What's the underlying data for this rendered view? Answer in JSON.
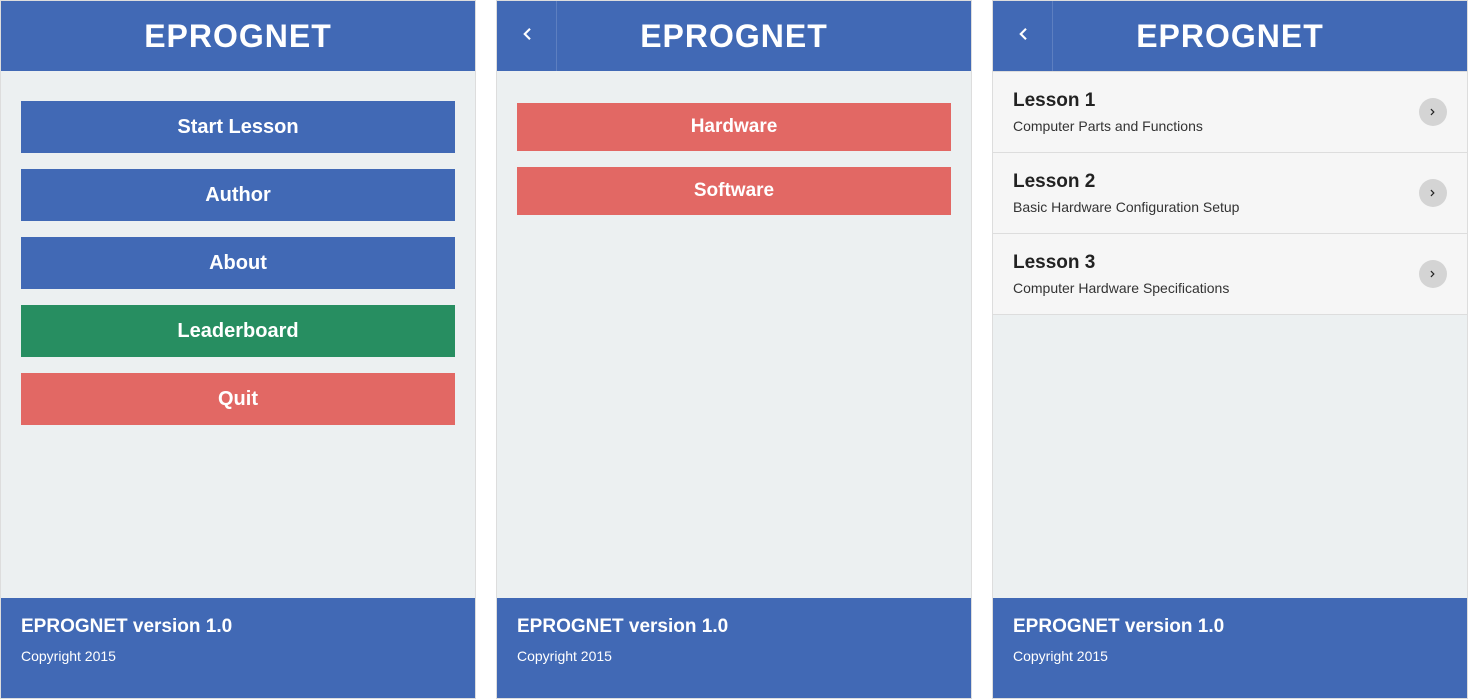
{
  "app_title": "EPROGNET",
  "footer": {
    "version": "EPROGNET version 1.0",
    "copyright": "Copyright 2015"
  },
  "screen1": {
    "buttons": {
      "start": "Start Lesson",
      "author": "Author",
      "about": "About",
      "leaderboard": "Leaderboard",
      "quit": "Quit"
    }
  },
  "screen2": {
    "buttons": {
      "hardware": "Hardware",
      "software": "Software"
    }
  },
  "screen3": {
    "lessons": [
      {
        "title": "Lesson 1",
        "subtitle": "Computer Parts and Functions"
      },
      {
        "title": "Lesson 2",
        "subtitle": "Basic Hardware Configuration Setup"
      },
      {
        "title": "Lesson 3",
        "subtitle": "Computer Hardware Specifications"
      }
    ]
  }
}
